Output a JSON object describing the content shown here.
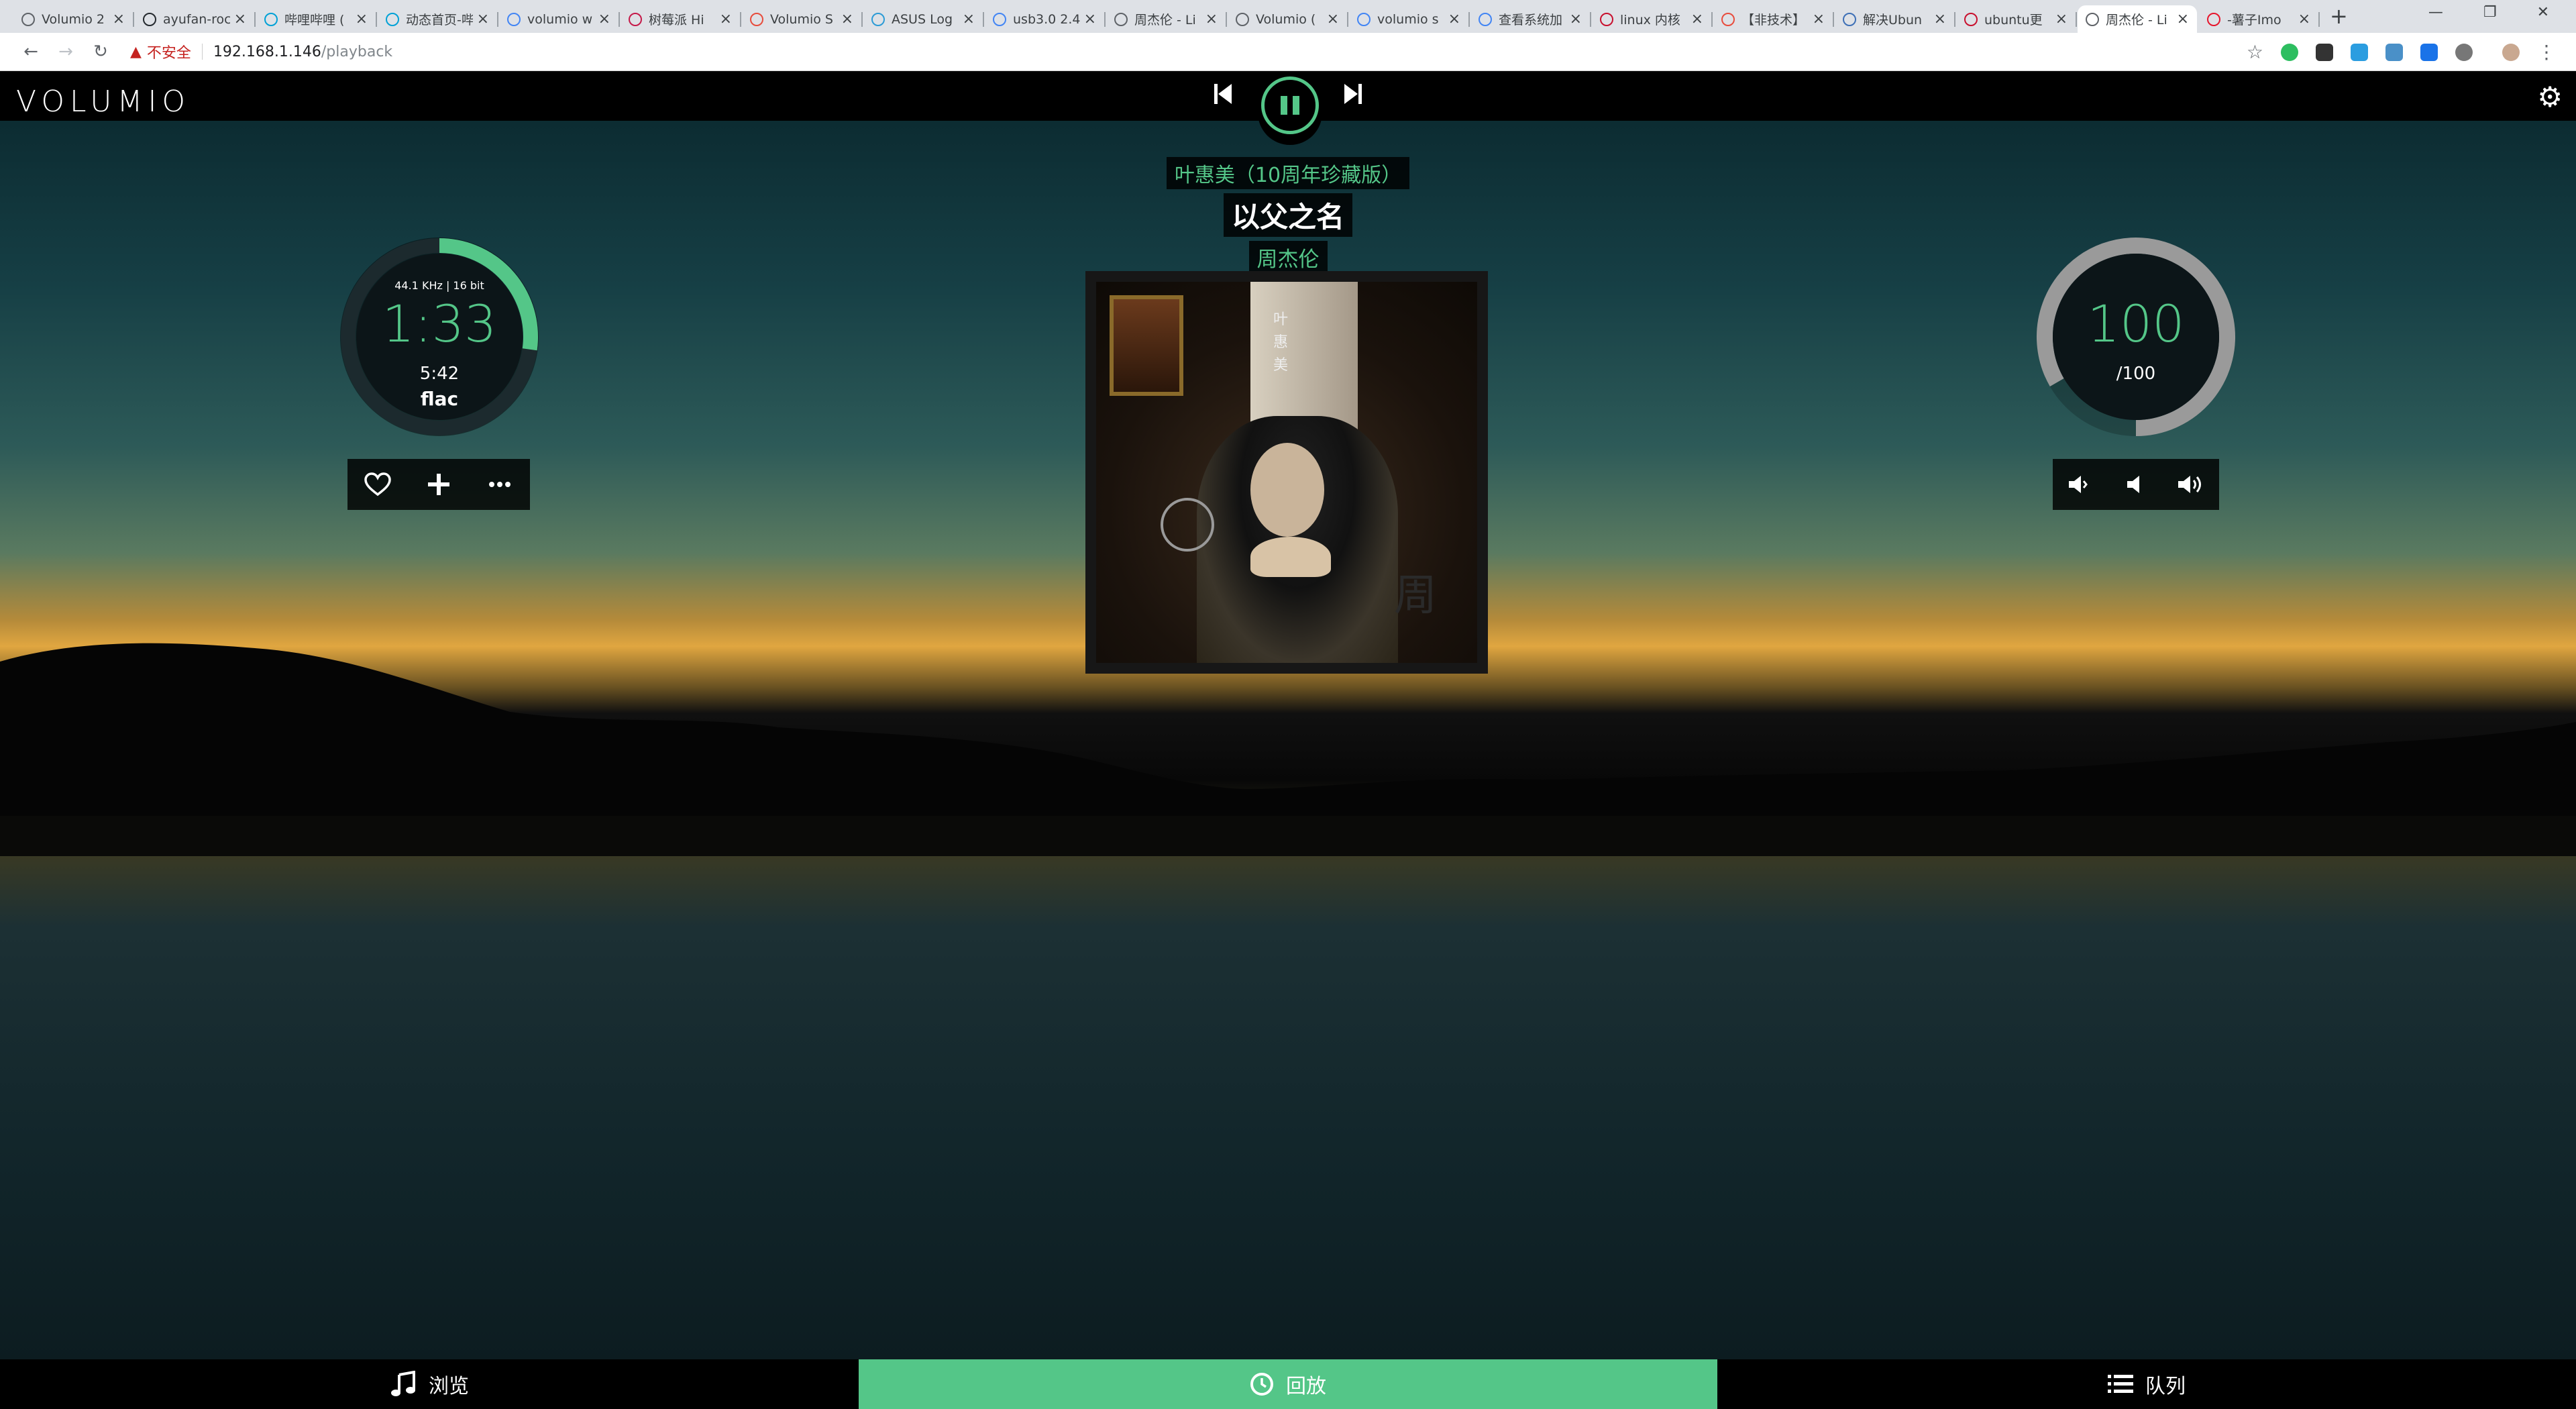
{
  "browser": {
    "tabs": [
      {
        "title": "Volumio 2"
      },
      {
        "title": "ayufan-rock"
      },
      {
        "title": "哔哩哔哩 ("
      },
      {
        "title": "动态首页-哔"
      },
      {
        "title": "volumio w"
      },
      {
        "title": "树莓派 Hi"
      },
      {
        "title": "Volumio S"
      },
      {
        "title": "ASUS Log"
      },
      {
        "title": "usb3.0 2.4"
      },
      {
        "title": "周杰伦 - Li"
      },
      {
        "title": "Volumio ("
      },
      {
        "title": "volumio s"
      },
      {
        "title": "查看系统加"
      },
      {
        "title": "linux 内核"
      },
      {
        "title": "【非技术】"
      },
      {
        "title": "解决Ubun"
      },
      {
        "title": "ubuntu更"
      },
      {
        "title": "周杰伦 - Li"
      },
      {
        "title": "-薯子Imo"
      }
    ],
    "active_tab": 17,
    "close_glyph": "×",
    "new_tab_glyph": "+",
    "security_label": "不安全",
    "url_host": "192.168.1.146",
    "url_path": "/playback"
  },
  "app": {
    "logo": "VOLUMIO",
    "track": {
      "album": "叶惠美（10周年珍藏版）",
      "title": "以父之名",
      "artist": "周杰伦"
    },
    "time": {
      "sample_rate": "44.1 KHz | 16 bit",
      "elapsed": "1:33",
      "duration": "5:42",
      "format": "flac",
      "progress_fraction": 0.272
    },
    "volume": {
      "level": "100",
      "max": "/100",
      "fraction": 1.0
    },
    "album_art_text": {
      "vertical_title": "叶惠美",
      "big_char": "周"
    },
    "nav": {
      "browse": "浏览",
      "playback": "回放",
      "queue": "队列"
    }
  },
  "colors": {
    "accent": "#54c688",
    "ring_track": "#1c2a2e",
    "volume_ring": "#9a9a9a"
  }
}
